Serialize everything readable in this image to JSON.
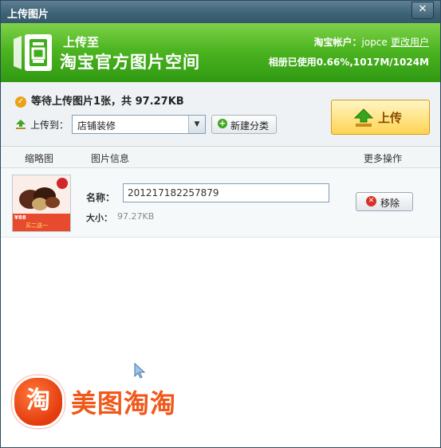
{
  "window": {
    "title": "上传图片",
    "close_glyph": "✕"
  },
  "header": {
    "brand_top": "上传至",
    "brand_main": "淘宝官方图片空间",
    "account_label": "淘宝帐户：",
    "account_user": "jopce",
    "switch_user_link": "更改用户",
    "space_label": "相册已使用",
    "space_value": "0.66%,1017M/1024M"
  },
  "infobar": {
    "status_text": "等待上传图片1张，共  97.27KB",
    "upload_to_label": "上传到：",
    "category_selected": "店铺装修",
    "new_category_label": "新建分类",
    "upload_button_label": "上传"
  },
  "table": {
    "columns": [
      "缩略图",
      "图片信息",
      "更多操作"
    ],
    "rows": [
      {
        "name_label": "名称：",
        "name_value": "201217182257879",
        "size_label": "大小：",
        "size_value": "97.27KB",
        "remove_label": "移除",
        "thumb_price": "¥88",
        "thumb_badge": "买二送一"
      }
    ]
  },
  "watermark": {
    "icon_char": "淘",
    "text": "美图淘淘"
  },
  "colors": {
    "title_bar": "#3e6276",
    "header_green": "#4db521",
    "upload_button": "#ffd452",
    "watermark_orange": "#f0581a"
  },
  "icons": [
    "logo-icon",
    "close-icon",
    "check-icon",
    "upload-arrow-icon",
    "dropdown-arrow-icon",
    "plus-icon",
    "remove-icon",
    "mouse-cursor-icon"
  ]
}
